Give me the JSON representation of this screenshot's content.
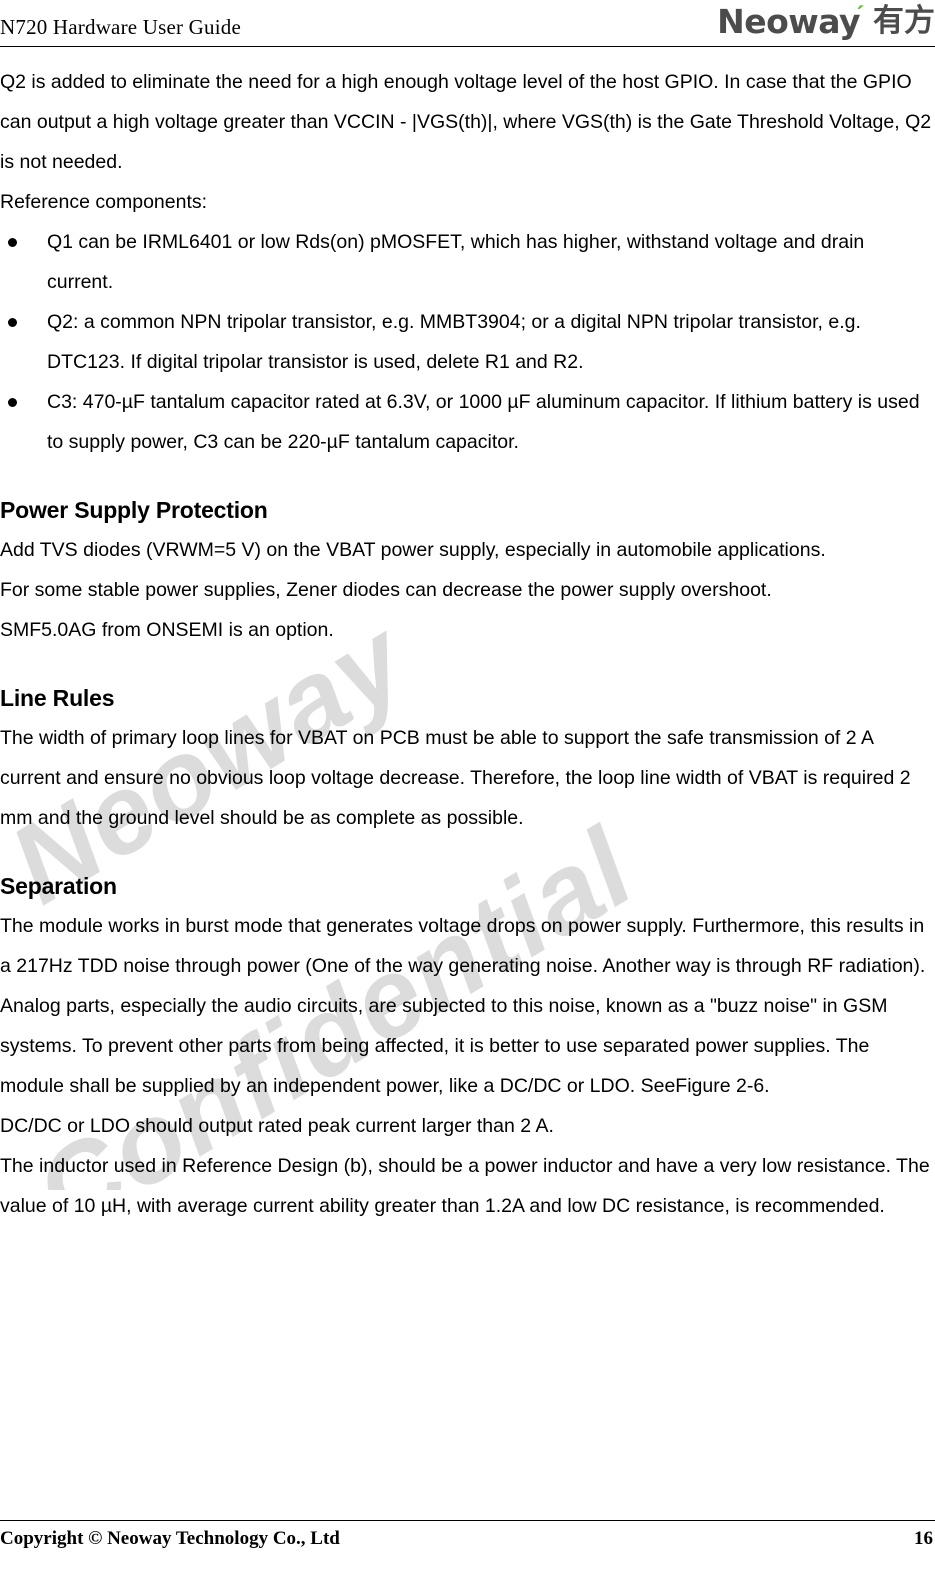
{
  "header": {
    "title": "N720 Hardware User Guide",
    "logo": {
      "wordmark": "Neoway",
      "tick": "ˊ",
      "chinese": "有方",
      "wordmark_color": "#4c4c4c",
      "tick_color": "#6fbe45"
    }
  },
  "watermark": {
    "line1": "Neoway",
    "line2": "Confidential",
    "color": "#dcdcdc"
  },
  "body": {
    "intro_paragraph": "Q2 is added to eliminate the need for a high enough voltage level of the host GPIO. In case that the GPIO can output a high voltage greater than VCCIN - |VGS(th)|, where VGS(th) is the Gate Threshold Voltage, Q2 is not needed.",
    "reference_label": "Reference components:",
    "reference_bullets": [
      "Q1 can be IRML6401 or low Rds(on) pMOSFET, which has higher, withstand voltage and drain current.",
      "Q2: a common NPN tripolar transistor, e.g. MMBT3904; or a digital NPN tripolar transistor, e.g. DTC123. If digital tripolar transistor is used, delete R1 and R2.",
      "C3: 470-µF tantalum capacitor rated at 6.3V, or 1000 µF aluminum capacitor. If lithium battery is used to supply power, C3 can be 220-µF tantalum capacitor."
    ],
    "sections": [
      {
        "heading": "Power Supply Protection",
        "paragraphs": [
          "Add TVS diodes (VRWM=5 V) on the VBAT power supply, especially in automobile applications.",
          "For some stable power supplies, Zener diodes can decrease the power supply overshoot.",
          "SMF5.0AG from ONSEMI is an option."
        ]
      },
      {
        "heading": "Line Rules",
        "paragraphs": [
          "The width of primary loop lines for VBAT on PCB must be able to support the safe transmission of 2 A current and ensure no obvious loop voltage decrease. Therefore, the loop line width of VBAT is required 2 mm and the ground level should be as complete as possible."
        ]
      },
      {
        "heading": "Separation",
        "paragraphs": [
          "The module works in burst mode that generates voltage drops on power supply. Furthermore, this results in a 217Hz TDD noise through power (One of the way generating noise. Another way is through RF radiation). Analog parts, especially the audio circuits, are subjected to this noise, known as a \"buzz noise\" in GSM systems. To prevent other parts from being affected, it is better to use separated power supplies. The module shall be supplied by an independent power, like a DC/DC or LDO. SeeFigure 2-6.",
          "DC/DC or LDO should output rated peak current larger than 2 A.",
          "The inductor used in Reference Design (b), should be a power inductor and have a very low resistance. The value of 10 µH, with average current ability greater than 1.2A and low DC resistance, is recommended."
        ]
      }
    ]
  },
  "footer": {
    "copyright": "Copyright © Neoway Technology Co., Ltd",
    "page_number": "16"
  }
}
